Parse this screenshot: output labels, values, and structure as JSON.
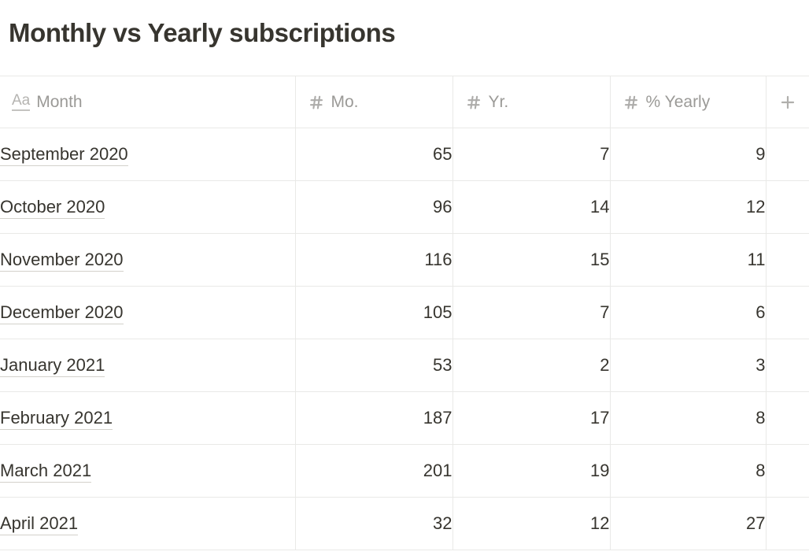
{
  "page_title": "Monthly vs Yearly subscriptions",
  "table": {
    "columns": [
      {
        "key": "month",
        "label": "Month",
        "icon": "text-aa-icon",
        "type": "title",
        "align": "left"
      },
      {
        "key": "mo",
        "label": "Mo.",
        "icon": "number-hash-icon",
        "type": "number",
        "align": "right"
      },
      {
        "key": "yr",
        "label": "Yr.",
        "icon": "number-hash-icon",
        "type": "number",
        "align": "right"
      },
      {
        "key": "pct",
        "label": "% Yearly",
        "icon": "number-hash-icon",
        "type": "number",
        "align": "right"
      }
    ],
    "add_column_label": "+",
    "aa_icon_text": "Aa",
    "rows": [
      {
        "month": "September 2020",
        "mo": "65",
        "yr": "7",
        "pct": "9"
      },
      {
        "month": "October 2020",
        "mo": "96",
        "yr": "14",
        "pct": "12"
      },
      {
        "month": "November 2020",
        "mo": "116",
        "yr": "15",
        "pct": "11"
      },
      {
        "month": "December 2020",
        "mo": "105",
        "yr": "7",
        "pct": "6"
      },
      {
        "month": "January 2021",
        "mo": "53",
        "yr": "2",
        "pct": "3"
      },
      {
        "month": "February 2021",
        "mo": "187",
        "yr": "17",
        "pct": "8"
      },
      {
        "month": "March 2021",
        "mo": "201",
        "yr": "19",
        "pct": "8"
      },
      {
        "month": "April 2021",
        "mo": "32",
        "yr": "12",
        "pct": "27"
      }
    ]
  },
  "colors": {
    "text": "#37352f",
    "muted": "#9b9a97",
    "border": "#e9e9e7",
    "background": "#ffffff"
  },
  "chart_data": {
    "type": "table",
    "title": "Monthly vs Yearly subscriptions",
    "columns": [
      "Month",
      "Mo.",
      "Yr.",
      "% Yearly"
    ],
    "categories": [
      "September 2020",
      "October 2020",
      "November 2020",
      "December 2020",
      "January 2021",
      "February 2021",
      "March 2021",
      "April 2021"
    ],
    "series": [
      {
        "name": "Mo.",
        "values": [
          65,
          96,
          116,
          105,
          53,
          187,
          201,
          32
        ]
      },
      {
        "name": "Yr.",
        "values": [
          7,
          14,
          15,
          7,
          2,
          17,
          19,
          12
        ]
      },
      {
        "name": "% Yearly",
        "values": [
          9,
          12,
          11,
          6,
          3,
          8,
          8,
          27
        ]
      }
    ],
    "xlabel": "Month",
    "ylabel": ""
  }
}
